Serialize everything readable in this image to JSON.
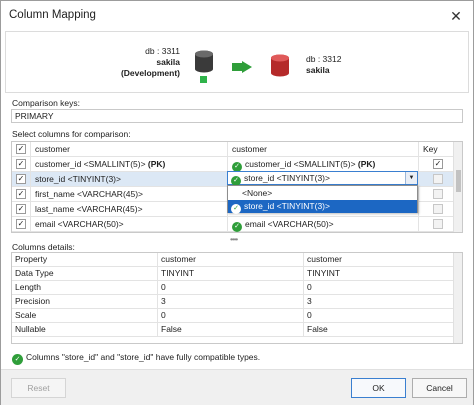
{
  "window": {
    "title": "Column Mapping",
    "close_glyph": "✕"
  },
  "source": {
    "db_line": "db : 3311",
    "name_line1": "sakila",
    "name_line2": "(Development)"
  },
  "target": {
    "db_line": "db : 3312",
    "name_line1": "sakila"
  },
  "colors": {
    "source_db": "#3a3a3a",
    "target_db": "#b52a2a",
    "arrow": "#2f9e3a",
    "selection": "#1c67c3",
    "ok": "#2f9e3a"
  },
  "comparison_keys": {
    "label": "Comparison keys:",
    "value": "PRIMARY"
  },
  "columns_section": {
    "label": "Select columns for comparison:",
    "headers": {
      "source": "customer",
      "target": "customer",
      "key": "Key"
    },
    "rows": [
      {
        "checked": true,
        "source": "customer_id <SMALLINT(5)>",
        "source_tag": "(PK)",
        "target": "customer_id <SMALLINT(5)>",
        "target_tag": "(PK)",
        "key": true,
        "selected": false
      },
      {
        "checked": true,
        "source": "store_id <TINYINT(3)>",
        "source_tag": "",
        "target": "store_id <TINYINT(3)>",
        "target_tag": "",
        "key": false,
        "selected": true
      },
      {
        "checked": true,
        "source": "first_name <VARCHAR(45)>",
        "source_tag": "",
        "target": "",
        "target_tag": "",
        "key": false,
        "selected": false
      },
      {
        "checked": true,
        "source": "last_name <VARCHAR(45)>",
        "source_tag": "",
        "target": "",
        "target_tag": "",
        "key": false,
        "selected": false
      },
      {
        "checked": true,
        "source": "email <VARCHAR(50)>",
        "source_tag": "",
        "target": "email <VARCHAR(50)>",
        "target_tag": "",
        "key": false,
        "selected": false
      }
    ],
    "dropdown": {
      "value": "store_id <TINYINT(3)>",
      "options": [
        "<None>",
        "store_id <TINYINT(3)>"
      ],
      "selected_index": 1
    }
  },
  "details_section": {
    "label": "Columns details:",
    "headers": [
      "Property",
      "customer",
      "customer"
    ],
    "rows": [
      [
        "Data Type",
        "TINYINT",
        "TINYINT"
      ],
      [
        "Length",
        "0",
        "0"
      ],
      [
        "Precision",
        "3",
        "3"
      ],
      [
        "Scale",
        "0",
        "0"
      ],
      [
        "Nullable",
        "False",
        "False"
      ]
    ]
  },
  "status": {
    "text": "Columns \"store_id\" and \"store_id\" have fully compatible types."
  },
  "buttons": {
    "reset": "Reset",
    "ok": "OK",
    "cancel": "Cancel"
  }
}
